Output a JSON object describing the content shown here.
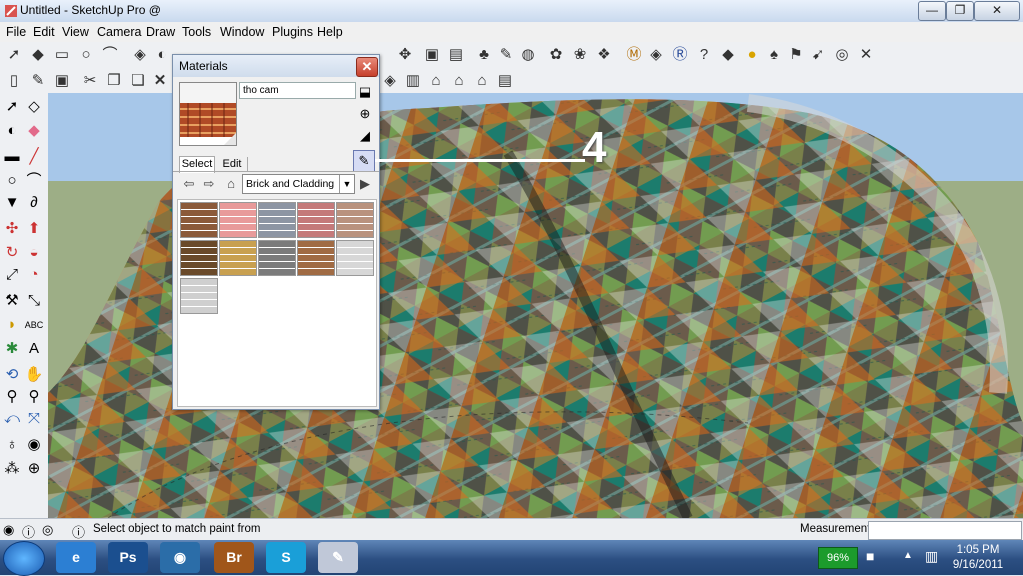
{
  "window": {
    "title": "Untitled - SketchUp Pro @",
    "min_label": "—",
    "max_label": "❐",
    "close_label": "✕"
  },
  "menu": [
    "File",
    "Edit",
    "View",
    "Camera",
    "Draw",
    "Tools",
    "Window",
    "Plugins",
    "Help"
  ],
  "materials": {
    "title": "Materials",
    "close_label": "✕",
    "material_name": "tho cam",
    "tabs": [
      "Select",
      "Edit"
    ],
    "library": "Brick and Cladding",
    "swatches": [
      "#8b5a3a",
      "#e89a9a",
      "#8d95a3",
      "#c47a7a",
      "#b9927e",
      "#6a4a2a",
      "#c8a050",
      "#7b7b7b",
      "#a06b44",
      "#d7d7d7",
      "#cfcfcf"
    ]
  },
  "annotation": {
    "number": "4"
  },
  "status": {
    "text": "Select object to match paint from",
    "measurements_label": "Measurements"
  },
  "taskbar": {
    "apps": [
      {
        "name": "ie-icon",
        "label": "e",
        "color": "#2c7fd3"
      },
      {
        "name": "photoshop-icon",
        "label": "Ps",
        "color": "#1b4f8f"
      },
      {
        "name": "globe-icon",
        "label": "◉",
        "color": "#2b6da8"
      },
      {
        "name": "bridge-icon",
        "label": "Br",
        "color": "#a0561a"
      },
      {
        "name": "skype-icon",
        "label": "S",
        "color": "#1a9fd8"
      },
      {
        "name": "sketchup-icon",
        "label": "✎",
        "color": "#c0c8d8"
      }
    ],
    "battery": "96%",
    "time": "1:05 PM",
    "date": "9/16/2011"
  }
}
